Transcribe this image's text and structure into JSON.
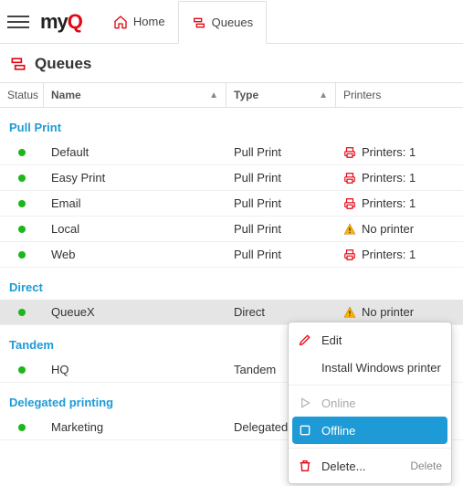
{
  "logo": {
    "text_black": "my",
    "text_red": "Q"
  },
  "nav": {
    "home": "Home",
    "queues": "Queues"
  },
  "page": {
    "title": "Queues"
  },
  "columns": {
    "status": "Status",
    "name": "Name",
    "type": "Type",
    "printers": "Printers"
  },
  "groups": [
    {
      "name": "Pull Print",
      "rows": [
        {
          "name": "Default",
          "type": "Pull Print",
          "printers_kind": "printer",
          "printers_text": "Printers: 1"
        },
        {
          "name": "Easy Print",
          "type": "Pull Print",
          "printers_kind": "printer",
          "printers_text": "Printers: 1"
        },
        {
          "name": "Email",
          "type": "Pull Print",
          "printers_kind": "printer",
          "printers_text": "Printers: 1"
        },
        {
          "name": "Local",
          "type": "Pull Print",
          "printers_kind": "warn",
          "printers_text": "No printer"
        },
        {
          "name": "Web",
          "type": "Pull Print",
          "printers_kind": "printer",
          "printers_text": "Printers: 1"
        }
      ]
    },
    {
      "name": "Direct",
      "rows": [
        {
          "name": "QueueX",
          "type": "Direct",
          "printers_kind": "warn",
          "printers_text": "No printer",
          "selected": true
        }
      ]
    },
    {
      "name": "Tandem",
      "rows": [
        {
          "name": "HQ",
          "type": "Tandem",
          "printers_kind": "",
          "printers_text": ""
        }
      ]
    },
    {
      "name": "Delegated printing",
      "rows": [
        {
          "name": "Marketing",
          "type": "Delegated",
          "printers_kind": "",
          "printers_text": ""
        }
      ]
    }
  ],
  "context_menu": {
    "edit": "Edit",
    "install": "Install Windows printer",
    "online": "Online",
    "offline": "Offline",
    "delete": "Delete...",
    "delete_hint": "Delete"
  },
  "colors": {
    "accent_red": "#e30613",
    "link_blue": "#1e9bd6",
    "status_green": "#1db61d"
  }
}
